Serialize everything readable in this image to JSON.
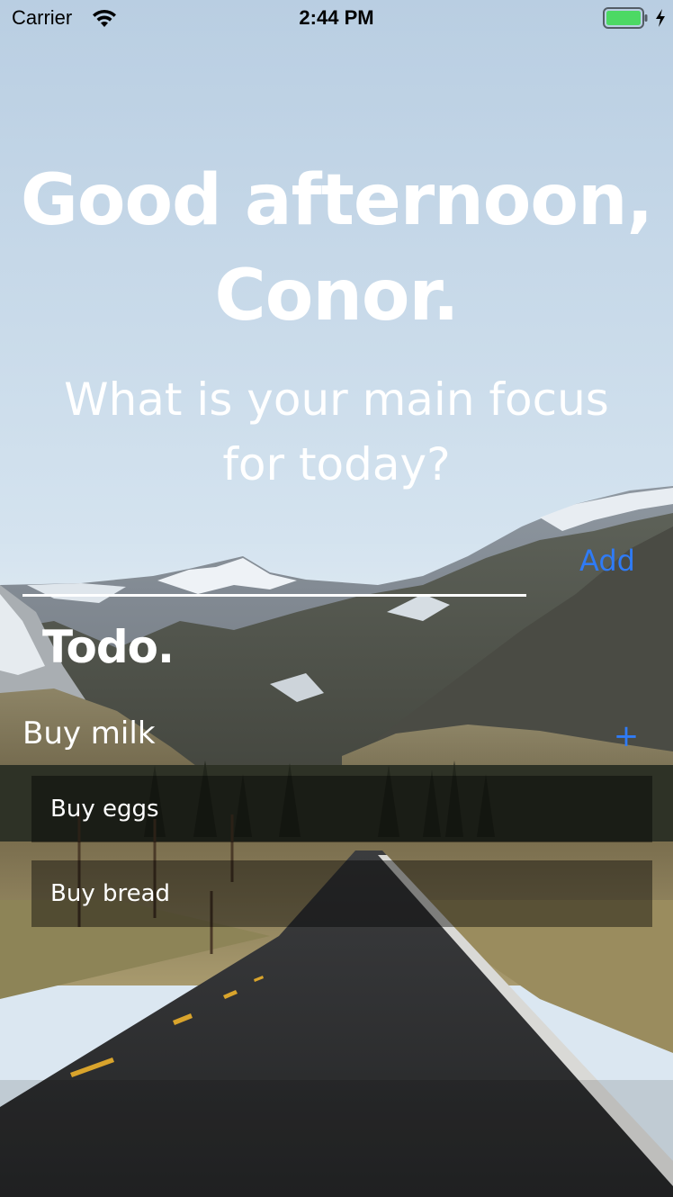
{
  "status_bar": {
    "carrier": "Carrier",
    "time": "2:44 PM",
    "icons": [
      "wifi-icon",
      "battery-icon",
      "charging-icon"
    ],
    "battery_color": "#4cd964"
  },
  "greeting": {
    "line1": "Good afternoon,",
    "line2": "Conor."
  },
  "focus": {
    "question": "What is your main focus for today?",
    "input_value": "",
    "add_label": "Add"
  },
  "todo": {
    "title": "Todo.",
    "new_item_value": "Buy milk",
    "add_label": "+",
    "items": [
      {
        "label": "Buy eggs"
      },
      {
        "label": "Buy bread"
      }
    ]
  },
  "colors": {
    "accent": "#2f7bf6",
    "text": "#ffffff"
  }
}
